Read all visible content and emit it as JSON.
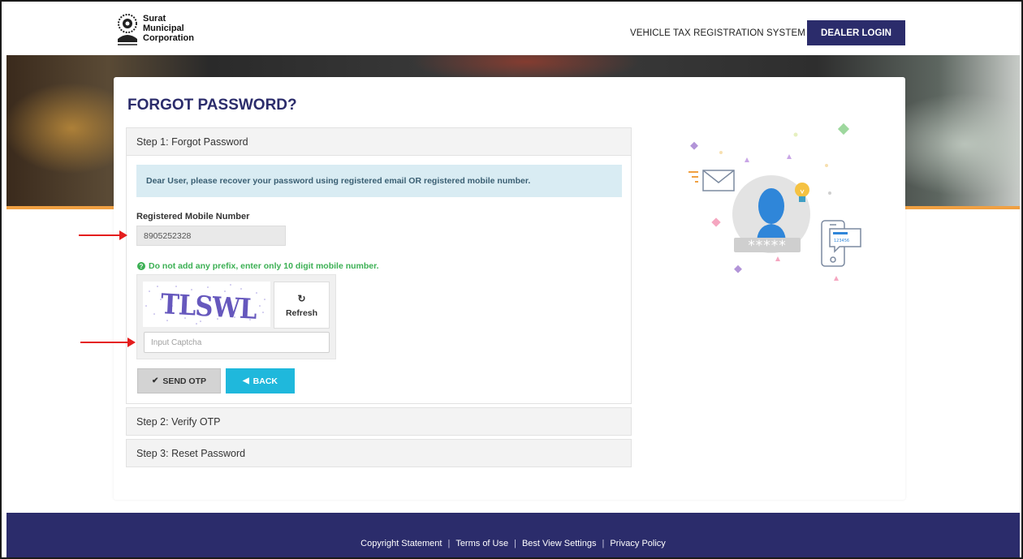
{
  "header": {
    "logo_lines": [
      "Surat",
      "Municipal",
      "Corporation"
    ],
    "system_title": "VEHICLE TAX REGISTRATION SYSTEM",
    "dealer_login_label": "DEALER LOGIN"
  },
  "page": {
    "title": "FORGOT PASSWORD?"
  },
  "steps": [
    {
      "label": "Step 1:  Forgot Password"
    },
    {
      "label": "Step 2:  Verify OTP"
    },
    {
      "label": "Step 3:  Reset Password"
    }
  ],
  "form": {
    "info_message": "Dear User, please recover your password using registered email OR registered mobile number.",
    "mobile_label": "Registered Mobile Number",
    "mobile_value": "8905252328",
    "hint": "Do not add any prefix, enter only 10 digit mobile number.",
    "captcha_text": "TLSWL",
    "refresh_label": "Refresh",
    "captcha_placeholder": "Input Captcha",
    "send_otp_label": "SEND OTP",
    "back_label": "BACK"
  },
  "illustration": {
    "password_mask": "*****",
    "phone_code": "123456"
  },
  "footer": {
    "links": [
      "Copyright Statement",
      "Terms of Use",
      "Best View Settings",
      "Privacy Policy"
    ]
  },
  "colors": {
    "brand_navy": "#2b2c6b",
    "info_blue": "#1fb8dc",
    "hint_green": "#3cb054",
    "accent_orange": "#f0a042",
    "arrow_red": "#e41d1d"
  }
}
